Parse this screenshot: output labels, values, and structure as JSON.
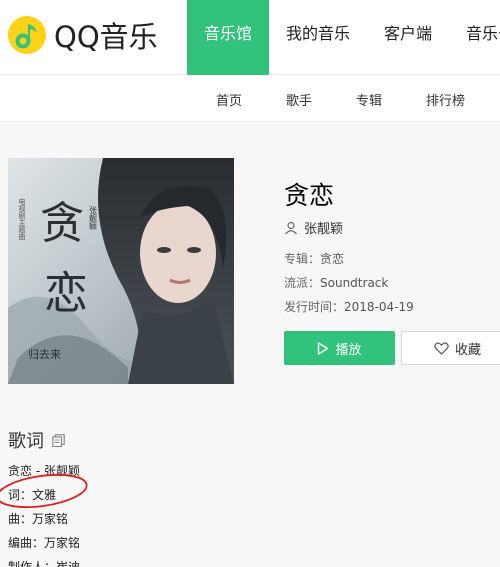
{
  "header": {
    "logo_text": "QQ音乐",
    "nav": [
      "音乐馆",
      "我的音乐",
      "客户端",
      "音乐号"
    ]
  },
  "subnav": [
    "首页",
    "歌手",
    "专辑",
    "排行榜"
  ],
  "album": {
    "cover_title": "贪恋",
    "cover_artist": "张靓颖",
    "cover_subtitle": "电视剧主题曲",
    "cover_series": "归去来"
  },
  "song": {
    "title": "贪恋",
    "singer": "张靓颖",
    "album_label": "专辑：",
    "album_value": "贪恋",
    "genre_label": "流派：",
    "genre_value": "Soundtrack",
    "release_label": "发行时间：",
    "release_value": "2018-04-19"
  },
  "actions": {
    "play": "播放",
    "favorite": "收藏"
  },
  "lyrics": {
    "heading": "歌词",
    "lines": [
      "贪恋 - 张靓颖",
      "词：文雅",
      "曲：万家铭",
      "编曲：万家铭",
      "制作人：崔迪"
    ]
  },
  "colors": {
    "brand_green": "#31c27c",
    "annotation_red": "#e02020"
  }
}
